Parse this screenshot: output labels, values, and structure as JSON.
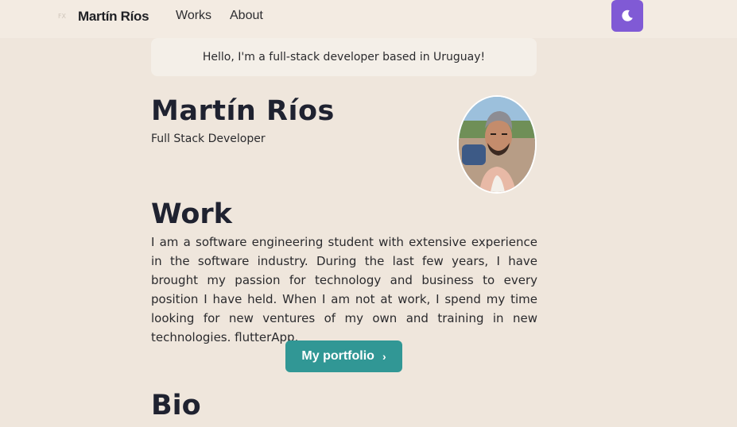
{
  "header": {
    "logo_glyph": "FX",
    "brand_name": "Martín Ríos",
    "nav": [
      {
        "label": "Works"
      },
      {
        "label": "About"
      }
    ],
    "theme_toggle_icon": "moon-icon"
  },
  "greeting": "Hello, I'm a full-stack developer based in Uruguay!",
  "profile": {
    "name": "Martín Ríos",
    "role": "Full Stack Developer",
    "avatar": "profile-photo"
  },
  "work": {
    "heading": "Work",
    "text": "I am a software engineering student with extensive experience in the software industry. During the last few years, I have brought my passion for technology and business to every position I have held. When I am not at work, I spend my time looking for new ventures of my own and training in new technologies. flutterApp.",
    "button_label": "My portfolio",
    "button_icon": "chevron-right-icon"
  },
  "bio": {
    "heading": "Bio"
  },
  "colors": {
    "background": "#efe6dc",
    "nav_background": "#f3ebe2",
    "toggle": "#805ad5",
    "button": "#319795",
    "heading": "#1f2230"
  }
}
